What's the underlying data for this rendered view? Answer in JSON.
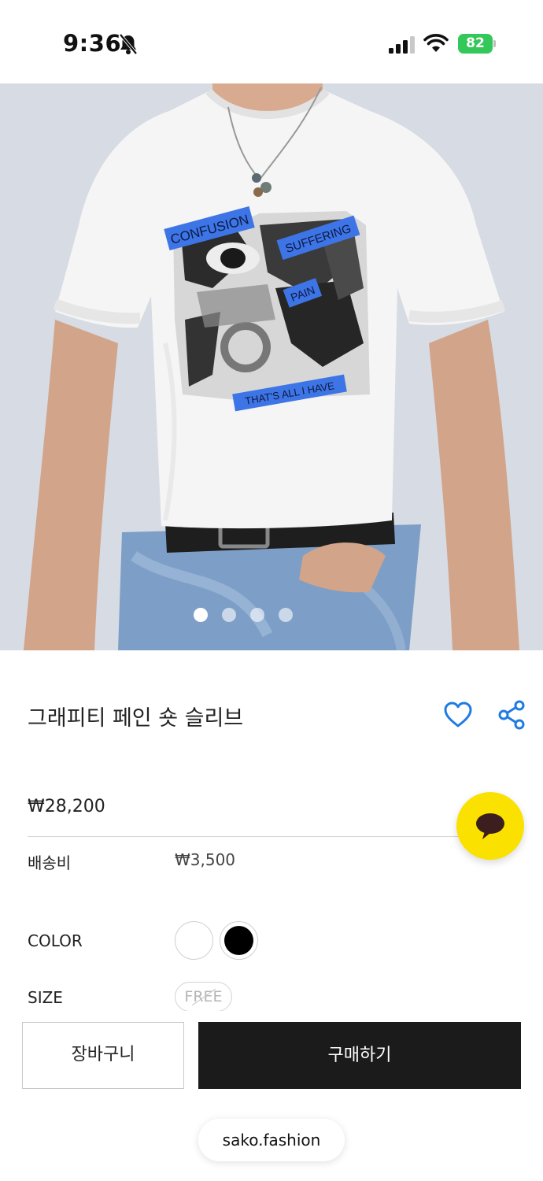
{
  "status_bar": {
    "time": "9:36",
    "battery": "82",
    "icons": [
      "bell-slash-icon",
      "signal-icon",
      "wifi-icon",
      "battery-charging-icon"
    ]
  },
  "product_image": {
    "print_text": {
      "confusion": "CONFUSION",
      "suffering": "SUFFERING",
      "pain": "PAIN",
      "all_i_have": "THAT'S ALL I HAVE"
    },
    "carousel": {
      "count": 4,
      "active_index": 0
    }
  },
  "product": {
    "title": "그래피티 페인 숏 슬리브",
    "price": "₩28,200",
    "shipping_label": "배송비",
    "shipping_value": "₩3,500"
  },
  "options": {
    "color_label": "COLOR",
    "colors": [
      "white",
      "black"
    ],
    "selected_color": "black",
    "size_label": "SIZE",
    "size_value": "FREE"
  },
  "actions": {
    "cart_label": "장바구니",
    "buy_label": "구매하기"
  },
  "footer": {
    "url": "sako.fashion"
  },
  "colors": {
    "accent": "#1f7be4",
    "kakao": "#fae100",
    "buy_button": "#1b1b1b",
    "print_blue": "#3d74e6",
    "battery": "#34c759"
  }
}
